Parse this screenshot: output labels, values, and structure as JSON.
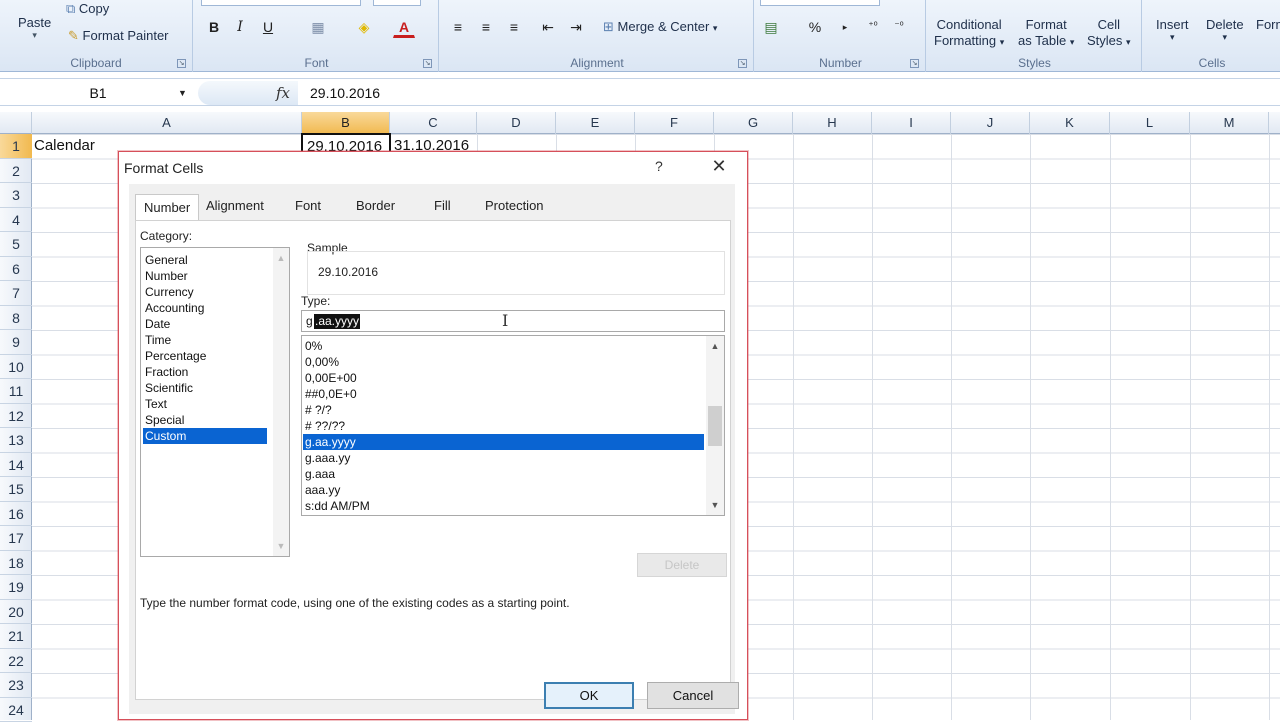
{
  "ribbon": {
    "clipboard": {
      "label": "Clipboard",
      "paste": "Paste",
      "copy": "Copy",
      "format_painter": "Format Painter"
    },
    "font": {
      "label": "Font",
      "bold": "B",
      "italic": "I",
      "underline": "U",
      "font_color": "A"
    },
    "alignment": {
      "label": "Alignment",
      "merge_center": "Merge & Center"
    },
    "number": {
      "label": "Number",
      "percent": "%"
    },
    "styles": {
      "label": "Styles",
      "conditional_formatting": [
        "Conditional",
        "Formatting"
      ],
      "format_as_table": [
        "Format",
        "as Table"
      ],
      "cell_styles": [
        "Cell",
        "Styles"
      ]
    },
    "cells": {
      "label": "Cells",
      "insert": "Insert",
      "delete": "Delete",
      "format": "Form"
    }
  },
  "formula_bar": {
    "name_box": "B1",
    "formula": "29.10.2016"
  },
  "grid": {
    "columns": [
      "A",
      "B",
      "C",
      "D",
      "E",
      "F",
      "G",
      "H",
      "I",
      "J",
      "K",
      "L",
      "M"
    ],
    "rows": [
      "1",
      "2",
      "3",
      "4",
      "5",
      "6",
      "7",
      "8",
      "9",
      "10",
      "11",
      "12",
      "13",
      "14",
      "15",
      "16",
      "17",
      "18",
      "19",
      "20",
      "21",
      "22",
      "23",
      "24"
    ],
    "cells": {
      "A1": "Calendar",
      "B1": "29.10.2016",
      "C1": "31.10.2016"
    }
  },
  "dialog": {
    "title": "Format Cells",
    "help": "?",
    "close": "✕",
    "tabs": [
      "Number",
      "Alignment",
      "Font",
      "Border",
      "Fill",
      "Protection"
    ],
    "category_label": "Category:",
    "categories": [
      "General",
      "Number",
      "Currency",
      "Accounting",
      "Date",
      "Time",
      "Percentage",
      "Fraction",
      "Scientific",
      "Text",
      "Special",
      "Custom"
    ],
    "selected_category": "Custom",
    "sample_label": "Sample",
    "sample_value": "29.10.2016",
    "type_label": "Type:",
    "type_value_prefix": "g",
    "type_value_selected": ".aa.yyyy",
    "type_items": [
      "0%",
      "0,00%",
      "0,00E+00",
      "##0,0E+0",
      "# ?/?",
      "# ??/??",
      "g.aa.yyyy",
      "g.aaa.yy",
      "g.aaa",
      "aaa.yy",
      "s:dd AM/PM"
    ],
    "selected_type": "g.aa.yyyy",
    "delete_button": "Delete",
    "hint": "Type the number format code, using one of the existing codes as a starting point.",
    "ok": "OK",
    "cancel": "Cancel"
  }
}
